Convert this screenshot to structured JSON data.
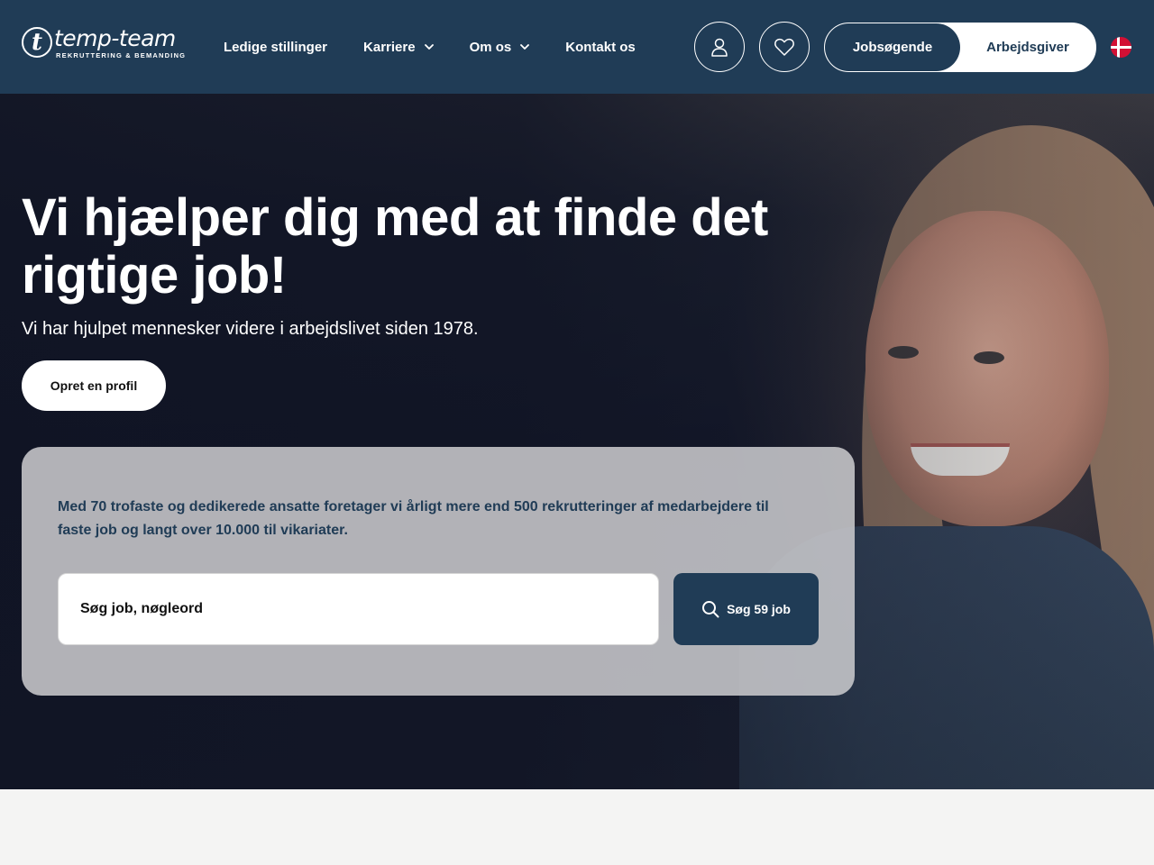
{
  "header": {
    "logo": {
      "name": "temp-team",
      "tagline": "REKRUTTERING & BEMANDING",
      "mark": "t"
    },
    "nav": [
      {
        "label": "Ledige stillinger",
        "has_dropdown": false
      },
      {
        "label": "Karriere",
        "has_dropdown": true
      },
      {
        "label": "Om os",
        "has_dropdown": true
      },
      {
        "label": "Kontakt os",
        "has_dropdown": false
      }
    ],
    "icons": {
      "profile": "user-icon",
      "favorites": "heart-icon",
      "dropdown": "chevron-down-icon"
    },
    "audience_toggle": {
      "active": "Jobsøgende",
      "inactive": "Arbejdsgiver"
    },
    "language": "danish-flag-icon"
  },
  "hero": {
    "title": "Vi hjælper dig med at finde det rigtige job!",
    "subtitle": "Vi har hjulpet mennesker videre i arbejdslivet siden 1978.",
    "cta_label": "Opret en profil"
  },
  "search": {
    "description": "Med 70 trofaste og dedikerede ansatte foretager vi årligt mere end 500 rekrutteringer af medarbejdere til faste job og langt over 10.000 til vikariater.",
    "placeholder": "Søg job, nøgleord",
    "button_label": "Søg 59 job"
  },
  "colors": {
    "primary": "#203c56",
    "background": "#f4f4f3",
    "flag_red": "#d21034"
  }
}
